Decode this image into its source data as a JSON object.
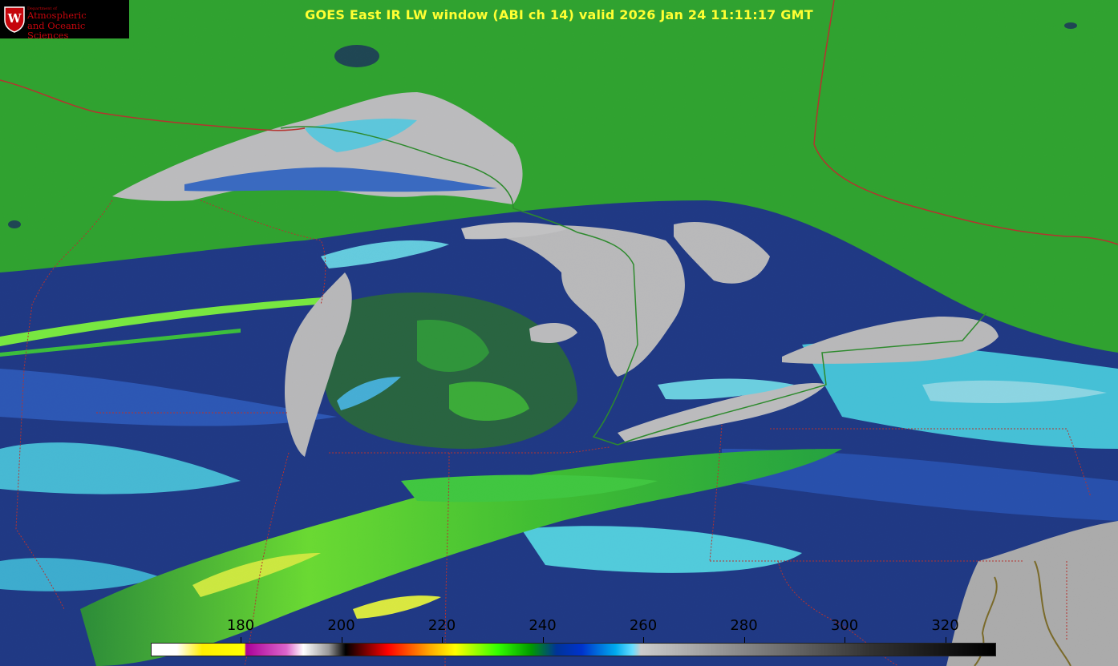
{
  "title": "GOES East IR LW window (ABI ch 14) valid 2026 Jan 24 11:11:17 GMT",
  "logo": {
    "department": "Department of",
    "line1": "Atmospheric",
    "line2": "and Oceanic Sciences",
    "crest_letter": "W",
    "crest_color": "#c5050c"
  },
  "colorbar": {
    "ticks": [
      "180",
      "200",
      "220",
      "240",
      "260",
      "280",
      "300",
      "320"
    ],
    "colors": [
      "#ffffff",
      "#ffff00",
      "#aa00aa",
      "#ffffff",
      "#000000",
      "#ff0000",
      "#ffff00",
      "#00ff00",
      "#00008b",
      "#00ccff",
      "#cccccc",
      "#000000"
    ]
  },
  "colors": {
    "land_green": "#22c422",
    "bright_green": "#66ff33",
    "navy": "#0a1a6e",
    "cyan": "#3fd8f2",
    "gray": "#bdbdbd",
    "border_red": "#b5332f",
    "border_green": "#2d8a2d"
  }
}
